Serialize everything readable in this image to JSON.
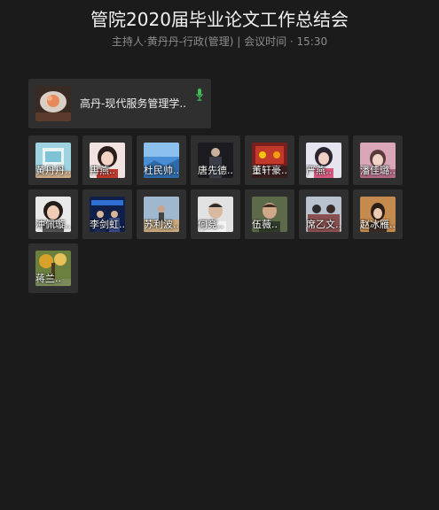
{
  "meeting": {
    "title": "管院2020届毕业论文工作总结会",
    "host_line": "主持人·黄丹丹-行政(管理) | 会议时间 · 15:30"
  },
  "active_speaker": {
    "name": "高丹-现代服务管理学..",
    "mic_icon": "microphone-icon",
    "mic_color": "#3fbe5c"
  },
  "participants": [
    {
      "name": "黄丹丹.."
    },
    {
      "name": "冉燕.."
    },
    {
      "name": "杜民帅.."
    },
    {
      "name": "唐先德.."
    },
    {
      "name": "董轩豪.."
    },
    {
      "name": "严燕.."
    },
    {
      "name": "潘佳璐.."
    },
    {
      "name": "冲佩璇.."
    },
    {
      "name": "李剑虹.."
    },
    {
      "name": "苏利波.."
    },
    {
      "name": "何竞.."
    },
    {
      "name": "伍薇.."
    },
    {
      "name": "席乙文.."
    },
    {
      "name": "赵冰雁.."
    },
    {
      "name": "蒋兰.."
    }
  ]
}
